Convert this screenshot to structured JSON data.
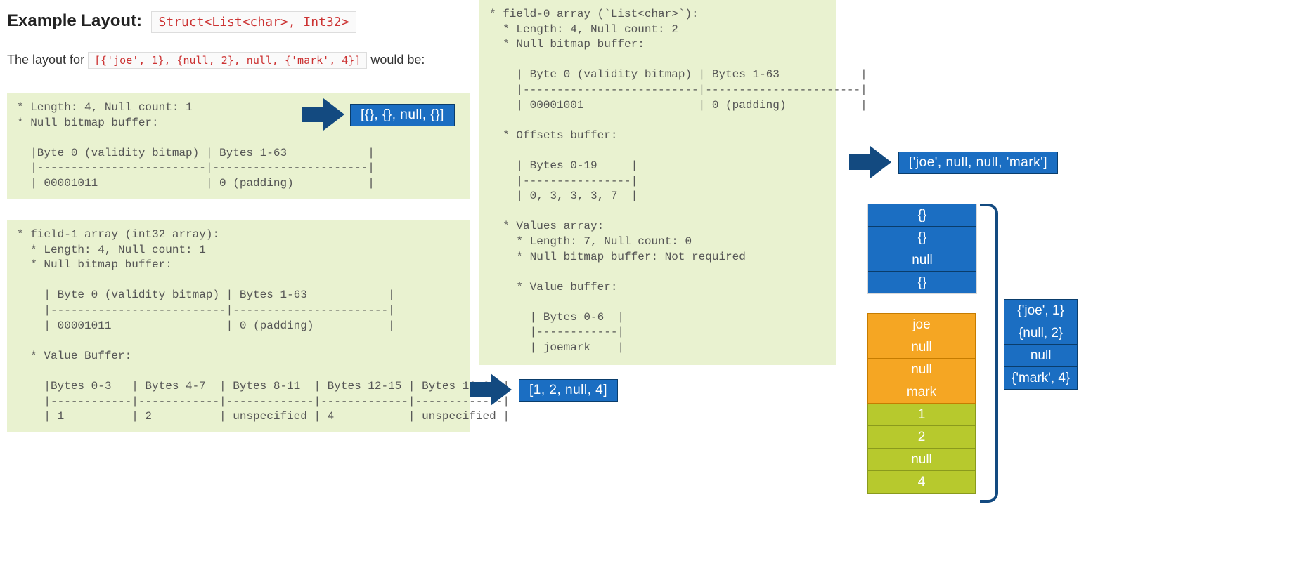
{
  "header": {
    "title": "Example Layout:",
    "type": "Struct<List<char>, Int32>",
    "intro_left": "The layout for ",
    "data": "[{'joe', 1}, {null, 2}, null, {'mark', 4}]",
    "intro_right": " would be:"
  },
  "blocks": {
    "struct": "* Length: 4, Null count: 1\n* Null bitmap buffer:\n\n  |Byte 0 (validity bitmap) | Bytes 1-63            |\n  |-------------------------|-----------------------|\n  | 00001011                | 0 (padding)           |",
    "field1": "* field-1 array (int32 array):\n  * Length: 4, Null count: 1\n  * Null bitmap buffer:\n\n    | Byte 0 (validity bitmap) | Bytes 1-63            |\n    |--------------------------|-----------------------|\n    | 00001011                 | 0 (padding)           |\n\n  * Value Buffer:\n\n    |Bytes 0-3   | Bytes 4-7  | Bytes 8-11  | Bytes 12-15 | Bytes 16-63 |\n    |------------|------------|-------------|-------------|-------------|\n    | 1          | 2          | unspecified | 4           | unspecified |",
    "field0": "* field-0 array (`List<char>`):\n  * Length: 4, Null count: 2\n  * Null bitmap buffer:\n\n    | Byte 0 (validity bitmap) | Bytes 1-63            |\n    |--------------------------|-----------------------|\n    | 00001001                 | 0 (padding)           |\n\n  * Offsets buffer:\n\n    | Bytes 0-19     |\n    |----------------|\n    | 0, 3, 3, 3, 7  |\n\n  * Values array:\n    * Length: 7, Null count: 0\n    * Null bitmap buffer: Not required\n\n    * Value buffer:\n\n      | Bytes 0-6  |\n      |------------|\n      | joemark    |"
  },
  "callouts": {
    "struct": "[{}, {}, null, {}]",
    "field1": "[1, 2, null, 4]",
    "field0": "['joe', null, null, 'mark']"
  },
  "stacks": {
    "struct_slots": [
      "{}",
      "{}",
      "null",
      "{}"
    ],
    "list_slots": [
      "joe",
      "null",
      "null",
      "mark"
    ],
    "int_slots": [
      "1",
      "2",
      "null",
      "4"
    ],
    "result": [
      "{'joe', 1}",
      "{null, 2}",
      "null",
      "{'mark', 4}"
    ]
  },
  "colors": {
    "code_bg": "#e9f2d0",
    "callout_blue": "#1b6ec2",
    "arrow_navy": "#134a80",
    "orange": "#f5a623",
    "olive": "#b7c92d",
    "type_red": "#c33"
  }
}
